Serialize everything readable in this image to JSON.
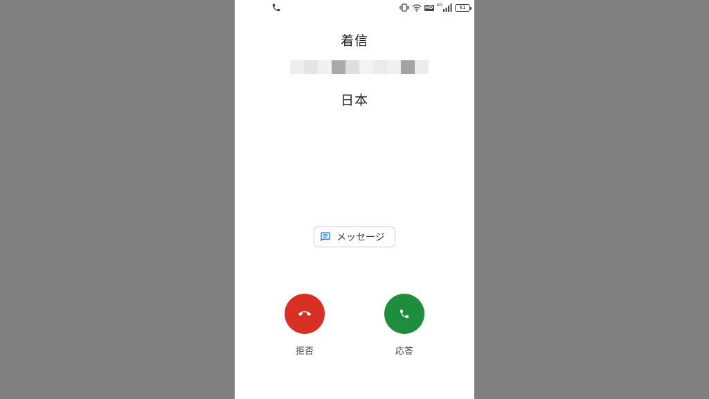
{
  "status_bar": {
    "icons": [
      "call-icon",
      "vibrate-icon",
      "wifi-icon",
      "hd-icon",
      "signal-icon",
      "battery-icon"
    ],
    "hd_label": "HD",
    "network_label": "4G",
    "battery_level": "61"
  },
  "call": {
    "status": "着信",
    "location": "日本"
  },
  "message_button": {
    "label": "メッセージ"
  },
  "actions": {
    "decline_label": "拒否",
    "answer_label": "応答"
  },
  "colors": {
    "decline": "#d93025",
    "answer": "#1e8e3e",
    "message_icon": "#1a73e8"
  }
}
